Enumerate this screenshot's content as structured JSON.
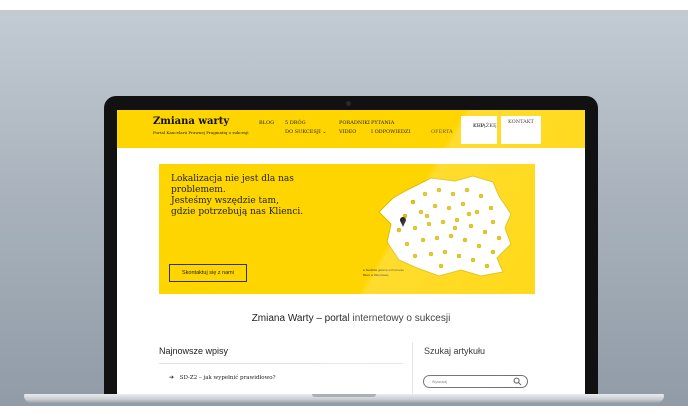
{
  "site": {
    "title": "Zmiana warty",
    "tagline": "Portal Kancelarii Prawnej Pragmatiq o sukcesji"
  },
  "nav": {
    "blog": "BLOG",
    "drogi_line1": "5 DRÓG",
    "drogi_line2": "DO SUKCESJI",
    "drogi_chevron": "⌄",
    "poradniki_line1": "PORADNIKI",
    "poradniki_line2": "VIDEO",
    "pytania_line1": "PYTANIA",
    "pytania_line2": "I ODPOWIEDZI",
    "oferta": "OFERTA",
    "kup_line1": "KUP",
    "kup_line2": "KSIĄŻKĘ",
    "kontakt": "KONTAKT"
  },
  "hero": {
    "heading_line1": "Lokalizacja nie jest dla nas",
    "heading_line2": "problemem.",
    "heading_line3": "Jesteśmy wszędzie tam,",
    "heading_line4": "gdzie potrzebują nas Klienci.",
    "button_label": "Skontaktuj się z nami",
    "legend_office": "Siedziba główna w Poznaniu",
    "legend_branch": "Biuro w Warszawie"
  },
  "main": {
    "portal_title": "Zmiana Warty – portal internetowy o sukcesji",
    "latest_title": "Najnowsze wpisy",
    "latest_posts": [
      "SD-Z2 – jak wypełnić prawidłowo?"
    ]
  },
  "sidebar": {
    "search_title": "Szukaj artykułu",
    "search_placeholder": "Wyszukaj"
  },
  "colors": {
    "brand_yellow": "#ffd500",
    "text_dark": "#222222"
  },
  "icons": {
    "arrow": "arrow-right-icon",
    "search": "magnifier-icon",
    "map_pin": "map-pin-icon"
  }
}
